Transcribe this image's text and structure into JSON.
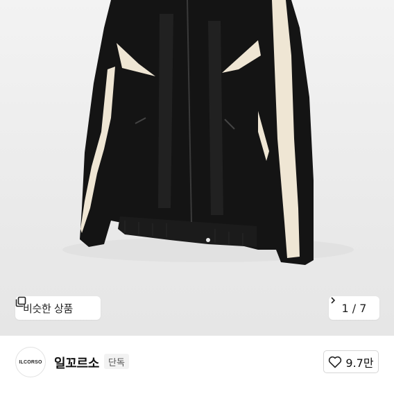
{
  "gallery": {
    "similar_button_label": "비슷한 상품",
    "counter_text": "1 / 7"
  },
  "seller": {
    "logo_text": "ILCORSO",
    "name": "일꼬르소",
    "badge": "단독",
    "like_count": "9.7만"
  },
  "icons": {
    "similar": "stacked-squares-icon",
    "counter_next": "chevron-right-icon",
    "like": "heart-outline-icon"
  }
}
